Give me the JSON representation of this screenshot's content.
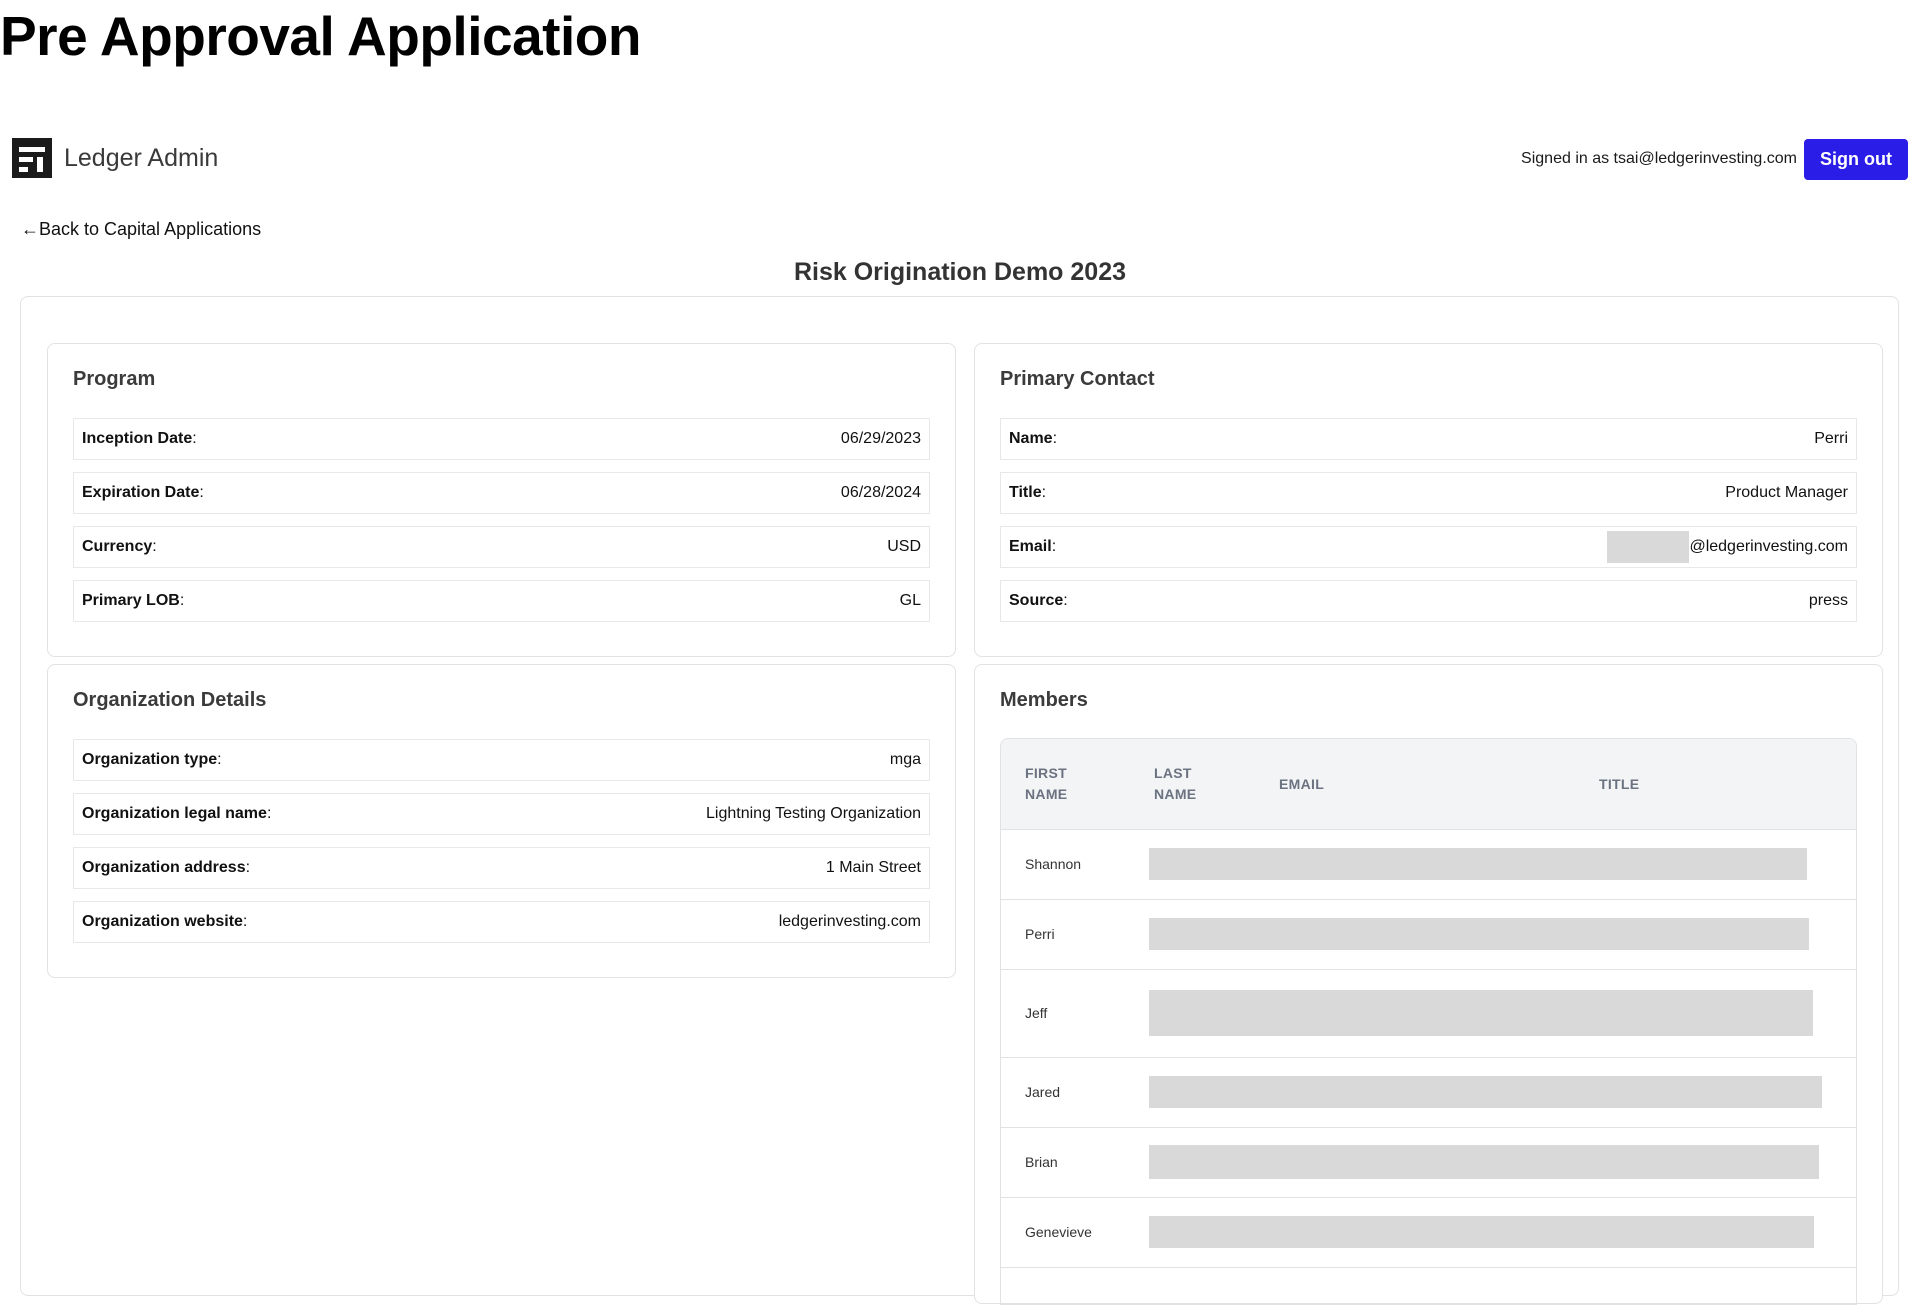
{
  "document_title": "Pre Approval Application",
  "header": {
    "brand_name": "Ledger Admin",
    "signed_in_text": "Signed in as tsai@ledgerinvesting.com",
    "sign_out_label": "Sign out",
    "colors": {
      "accent": "#2a1de8",
      "logo": "#1b1b1b"
    }
  },
  "nav": {
    "back_label": "←Back to Capital Applications"
  },
  "page_title": "Risk Origination Demo 2023",
  "program": {
    "title": "Program",
    "rows": [
      {
        "label": "Inception Date",
        "value": "06/29/2023"
      },
      {
        "label": "Expiration Date",
        "value": "06/28/2024"
      },
      {
        "label": "Currency",
        "value": "USD"
      },
      {
        "label": "Primary LOB",
        "value": "GL"
      }
    ]
  },
  "primary_contact": {
    "title": "Primary Contact",
    "rows": [
      {
        "label": "Name",
        "value": "Perri"
      },
      {
        "label": "Title",
        "value": "Product Manager"
      },
      {
        "label": "Email",
        "value": "@ledgerinvesting.com"
      },
      {
        "label": "Source",
        "value": "press"
      }
    ]
  },
  "organization": {
    "title": "Organization Details",
    "rows": [
      {
        "label": "Organization type",
        "value": "mga"
      },
      {
        "label": "Organization legal name",
        "value": "Lightning Testing Organization"
      },
      {
        "label": "Organization address",
        "value": "1 Main Street"
      },
      {
        "label": "Organization website",
        "value": "ledgerinvesting.com"
      }
    ]
  },
  "members": {
    "title": "Members",
    "columns": {
      "first_name_1": "FIRST",
      "first_name_2": "NAME",
      "last_name_1": "LAST",
      "last_name_2": "NAME",
      "email": "EMAIL",
      "title": "TITLE"
    },
    "rows": [
      {
        "first_name": "Shannon"
      },
      {
        "first_name": "Perri"
      },
      {
        "first_name": "Jeff"
      },
      {
        "first_name": "Jared"
      },
      {
        "first_name": "Brian"
      },
      {
        "first_name": "Genevieve"
      }
    ]
  }
}
